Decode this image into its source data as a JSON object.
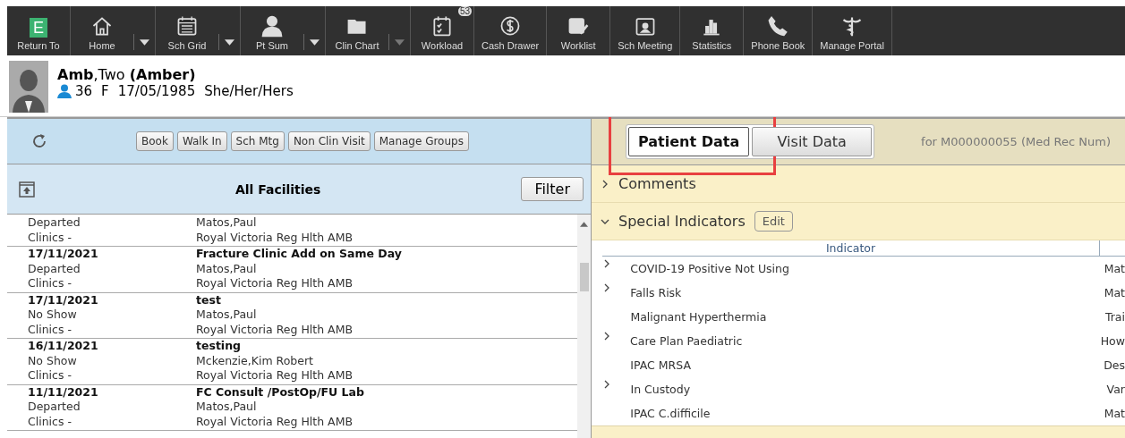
{
  "toolbar": [
    {
      "label": "Return To",
      "letter": "E"
    },
    {
      "label": "Home",
      "dropdown": {
        "disabled": false
      }
    },
    {
      "label": "Sch Grid",
      "dropdown": {
        "disabled": false
      }
    },
    {
      "label": "Pt Sum",
      "dropdown": {
        "disabled": false
      }
    },
    {
      "label": "Clin Chart",
      "dropdown": {
        "disabled": true
      }
    },
    {
      "label": "Workload",
      "badge": "53"
    },
    {
      "label": "Cash Drawer"
    },
    {
      "label": "Worklist"
    },
    {
      "label": "Sch Meeting"
    },
    {
      "label": "Statistics"
    },
    {
      "label": "Phone Book"
    },
    {
      "label": "Manage Portal"
    }
  ],
  "patient": {
    "surname": "Amb",
    "given": ",Two",
    "preferred": "(Amber)",
    "age": "36",
    "sex": "F",
    "dob": "17/05/1985",
    "pronouns": "She/Her/Hers"
  },
  "schedule": {
    "buttons": [
      "Book",
      "Walk In",
      "Sch Mtg",
      "Non Clin Visit",
      "Manage Groups"
    ],
    "title": "All Facilities",
    "filter": "Filter",
    "rows": [
      {
        "status": "Departed",
        "provider": "Matos,Paul",
        "location": "Clinics -",
        "facility": "Royal Victoria Reg Hlth AMB"
      },
      {
        "date": "17/11/2021",
        "title": "Fracture Clinic Add on Same Day",
        "status": "Departed",
        "provider": "Matos,Paul",
        "location": "Clinics -",
        "facility": "Royal Victoria Reg Hlth AMB"
      },
      {
        "date": "17/11/2021",
        "title": "test",
        "status": "No Show",
        "provider": "Matos,Paul",
        "location": "Clinics -",
        "facility": "Royal Victoria Reg Hlth AMB"
      },
      {
        "date": "16/11/2021",
        "title": "testing",
        "status": "No Show",
        "provider": "Mckenzie,Kim Robert",
        "location": "Clinics -",
        "facility": "Royal Victoria Reg Hlth AMB"
      },
      {
        "date": "11/11/2021",
        "title": "FC Consult /PostOp/FU Lab",
        "status": "Departed",
        "provider": "Matos,Paul",
        "location": "Clinics -",
        "facility": "Royal Victoria Reg Hlth AMB"
      }
    ]
  },
  "details": {
    "tabs": [
      {
        "label": "Patient Data",
        "selected": true,
        "highlighted": true
      },
      {
        "label": "Visit Data",
        "selected": false,
        "highlighted": false
      }
    ],
    "record": "for M000000055 (Med Rec Num)",
    "sections": [
      {
        "title": "Comments",
        "expanded": false
      },
      {
        "title": "Special Indicators",
        "expanded": true,
        "action": "Edit"
      }
    ],
    "columns": [
      "Indicator"
    ],
    "indicators": [
      {
        "name": "COVID-19 Positive Not Using",
        "column_2": "Mat",
        "expandable": true
      },
      {
        "name": "Falls Risk",
        "column_2": "Mat",
        "expandable": true
      },
      {
        "name": "Malignant Hyperthermia",
        "column_2": "Trai",
        "expandable": false
      },
      {
        "name": "Care Plan Paediatric",
        "column_2": "How",
        "expandable": true
      },
      {
        "name": "IPAC MRSA",
        "column_2": "Des",
        "expandable": false
      },
      {
        "name": "In Custody",
        "column_2": "Var",
        "expandable": true
      },
      {
        "name": "IPAC C.difficile",
        "column_2": "Mat",
        "expandable": false
      }
    ]
  }
}
